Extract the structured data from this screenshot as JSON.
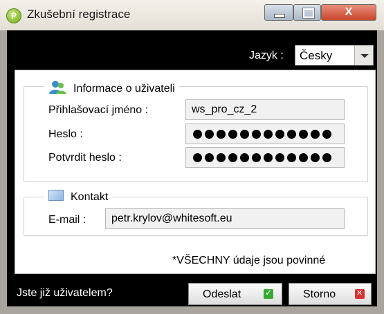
{
  "window": {
    "title": "Zkušební registrace",
    "app_icon_letter": "P",
    "close_glyph": "X"
  },
  "language": {
    "label": "Jazyk :",
    "selected": "Česky"
  },
  "user_info": {
    "legend": "Informace o uživateli",
    "login_label": "Přihlašovací jméno :",
    "login_value": "ws_pro_cz_2",
    "password_label": "Heslo :",
    "password_mask_length": 12,
    "confirm_label": "Potvrdit heslo :",
    "confirm_mask_length": 12
  },
  "contact": {
    "legend": "Kontakt",
    "email_label": "E-mail :",
    "email_value": "petr.krylov@whitesoft.eu"
  },
  "required_note": "*VŠECHNY údaje jsou povinné",
  "footer": {
    "already_user": "Jste již uživatelem?",
    "send_label": "Odeslat",
    "cancel_label": "Storno"
  },
  "colors": {
    "frame": "#a9a59e",
    "inner_bg": "#000000",
    "ok": "#35a836",
    "cancel": "#d83232"
  }
}
